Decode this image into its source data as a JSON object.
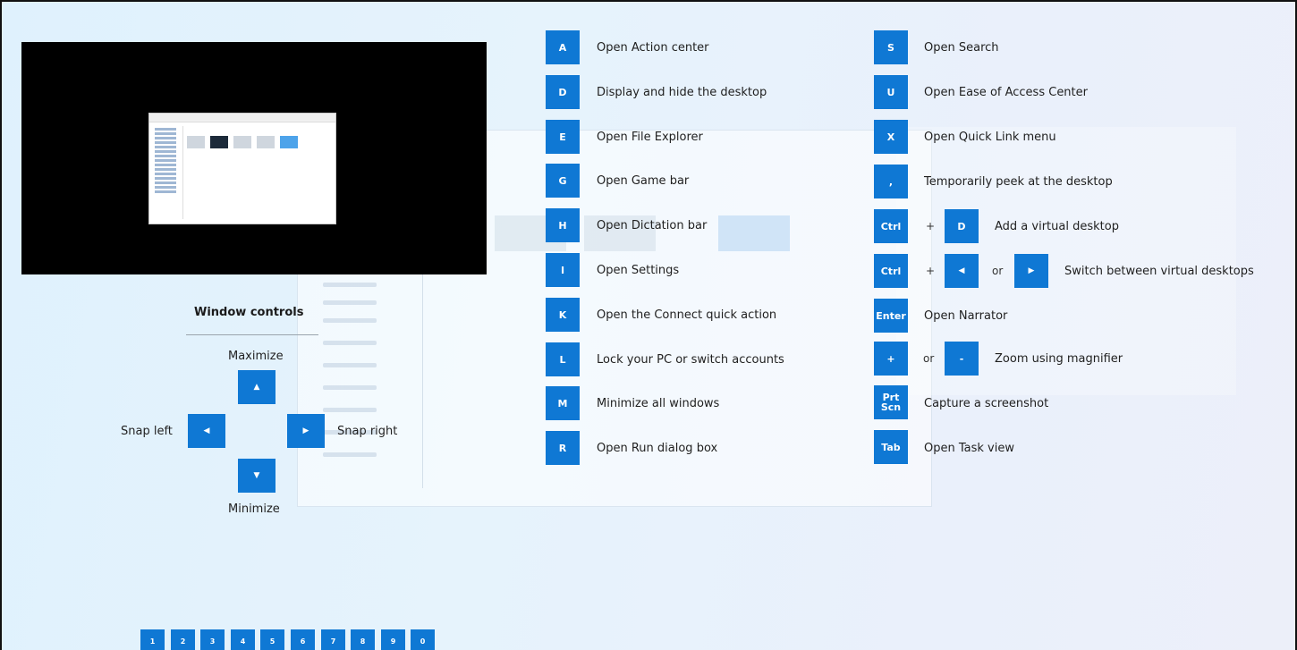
{
  "left_shortcuts": [
    {
      "key": "A",
      "label": "Open Action center"
    },
    {
      "key": "D",
      "label": "Display and hide the desktop"
    },
    {
      "key": "E",
      "label": "Open File Explorer"
    },
    {
      "key": "G",
      "label": "Open Game bar"
    },
    {
      "key": "H",
      "label": "Open Dictation bar"
    },
    {
      "key": "I",
      "label": "Open Settings"
    },
    {
      "key": "K",
      "label": "Open the Connect quick action"
    },
    {
      "key": "L",
      "label": "Lock your PC or switch accounts"
    },
    {
      "key": "M",
      "label": "Minimize all windows"
    },
    {
      "key": "R",
      "label": "Open Run dialog box"
    }
  ],
  "right_shortcuts": {
    "s": {
      "key": "S",
      "label": "Open Search"
    },
    "u": {
      "key": "U",
      "label": "Open Ease of Access Center"
    },
    "x": {
      "key": "X",
      "label": "Open Quick Link menu"
    },
    "comma": {
      "key": ",",
      "label": "Temporarily peek at the desktop"
    },
    "ctrl_d": {
      "key1": "Ctrl",
      "plus": "+",
      "key2": "D",
      "label": "Add a virtual desktop"
    },
    "ctrl_arrows": {
      "key1": "Ctrl",
      "plus": "+",
      "or": "or",
      "label": "Switch between virtual desktops"
    },
    "enter": {
      "key": "Enter",
      "label": "Open Narrator"
    },
    "zoom": {
      "key1": "+",
      "or": "or",
      "key2": "-",
      "label": "Zoom using magnifier"
    },
    "prtscn": {
      "key_line1": "Prt",
      "key_line2": "Scn",
      "label": "Capture a screenshot"
    },
    "tab": {
      "key": "Tab",
      "label": "Open Task view"
    }
  },
  "window_controls": {
    "title": "Window controls",
    "maximize": "Maximize",
    "minimize": "Minimize",
    "snap_left": "Snap left",
    "snap_right": "Snap right"
  },
  "number_keys": [
    "1",
    "2",
    "3",
    "4",
    "5",
    "6",
    "7",
    "8",
    "9",
    "0"
  ],
  "colors": {
    "key_blue": "#0f78d4",
    "preview_bg": "#000000"
  }
}
